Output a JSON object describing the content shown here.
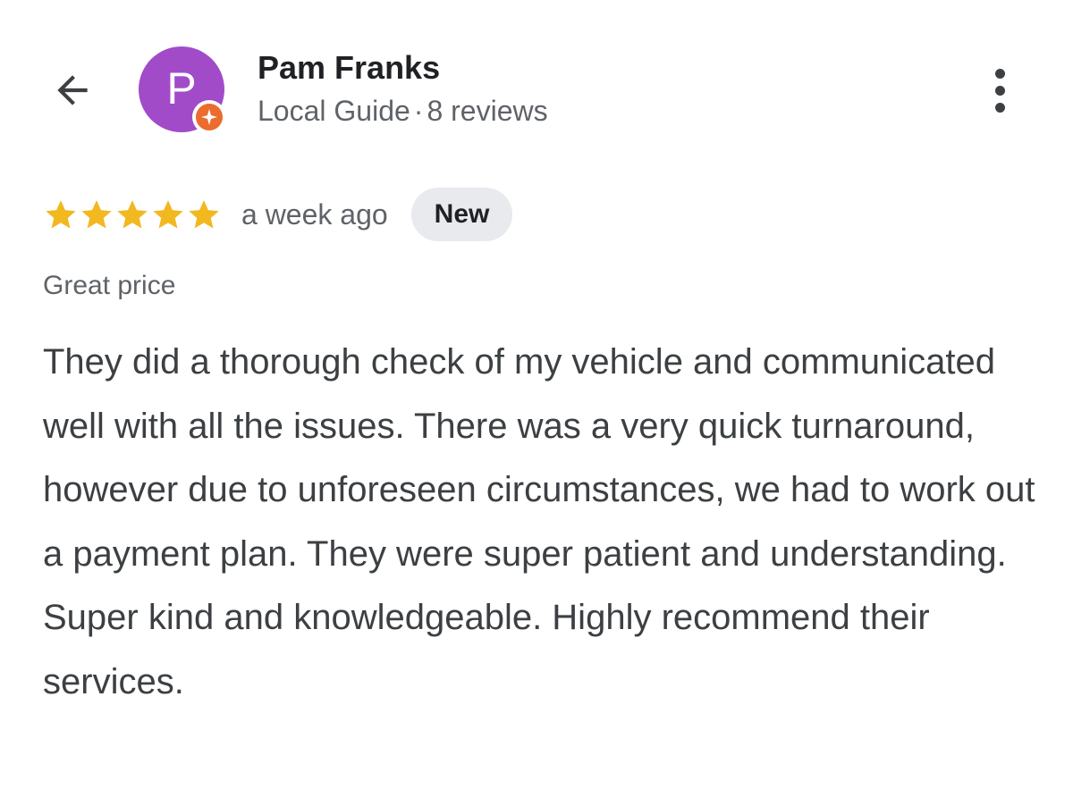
{
  "reviewer": {
    "avatar_letter": "P",
    "name": "Pam Franks",
    "role": "Local Guide",
    "separator": "·",
    "review_count": "8 reviews"
  },
  "review": {
    "stars": 5,
    "max_stars": 5,
    "time_ago": "a week ago",
    "badge": "New",
    "attribute": "Great price",
    "text": "They did a thorough check of my vehicle and communicated well with all the issues. There was a very quick turnaround, however due to unforeseen circumstances, we had to work out a payment plan. They were super patient and understanding. Super kind and knowledgeable. Highly recommend their services."
  },
  "icons": {
    "back": "arrow-back-icon",
    "more": "more-vertical-icon",
    "star": "star-icon",
    "guide_badge": "local-guide-badge-icon"
  },
  "colors": {
    "avatar_bg": "#a24bc9",
    "star": "#f2b81f",
    "guide_badge": "#ec6b2d",
    "badge_bg": "#e8eaed",
    "muted_text": "#5f6368",
    "body_text": "#3c4043"
  }
}
